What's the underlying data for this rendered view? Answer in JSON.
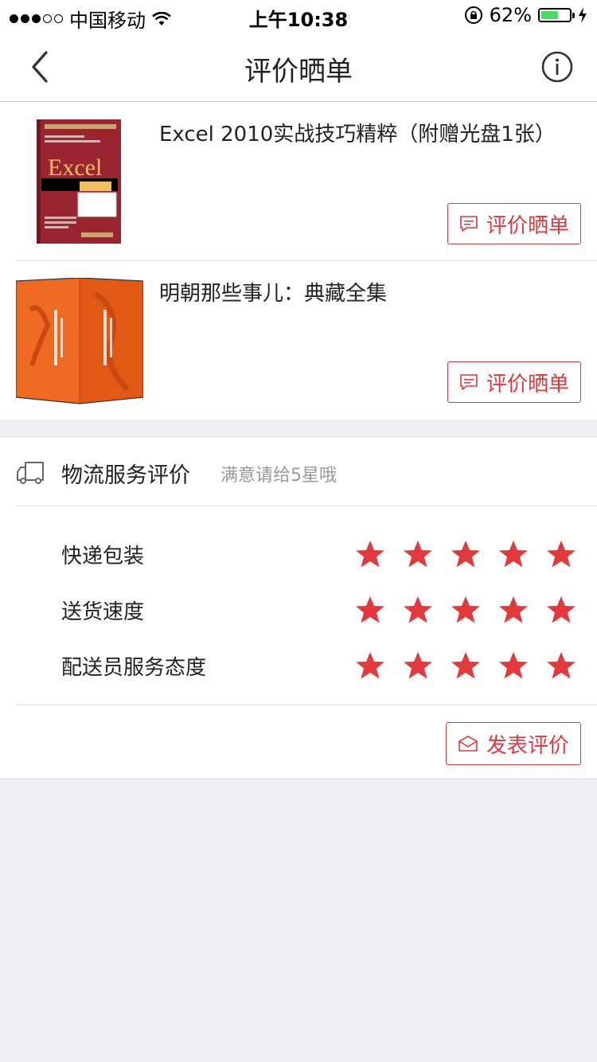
{
  "status_bar": {
    "carrier": "中国移动",
    "time": "上午10:38",
    "battery_text": "62%",
    "battery_level": 0.62
  },
  "nav": {
    "title": "评价晒单"
  },
  "products": [
    {
      "title": "Excel 2010实战技巧精粹（附赠光盘1张）",
      "button_label": "评价晒单"
    },
    {
      "title": "明朝那些事儿：典藏全集",
      "button_label": "评价晒单"
    }
  ],
  "logistics": {
    "title": "物流服务评价",
    "hint": "满意请给5星哦",
    "criteria": [
      {
        "label": "快递包装",
        "stars": 5
      },
      {
        "label": "送货速度",
        "stars": 5
      },
      {
        "label": "配送员服务态度",
        "stars": 5
      }
    ],
    "max_stars": 5
  },
  "submit_label": "发表评价",
  "colors": {
    "accent": "#e4393c",
    "star": "#e4393c",
    "battery": "#4cd964",
    "background": "#efeff4"
  }
}
